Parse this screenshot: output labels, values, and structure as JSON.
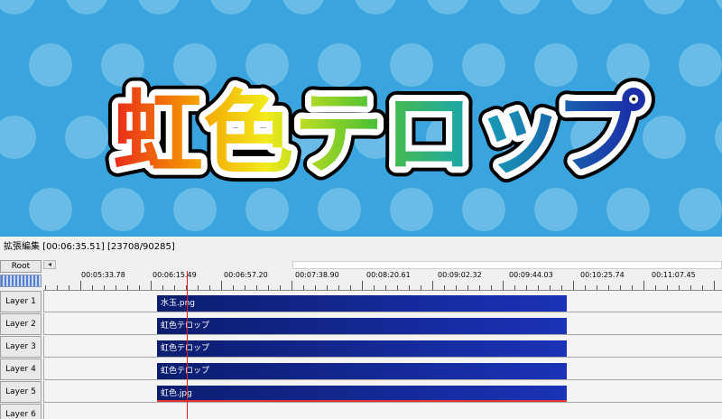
{
  "preview": {
    "title_chars": [
      "虹",
      "色",
      "テ",
      "ロ",
      "ッ",
      "プ"
    ],
    "background_color": "#3aa4de",
    "dot_color": "#6bbbe8"
  },
  "timeline": {
    "title": "拡張編集 [00:06:35.51] [23708/90285]",
    "root_label": "Root",
    "scroll_left_icon": "◂",
    "ruler_labels": [
      "00:05:33.78",
      "00:06:15.49",
      "00:06:57.20",
      "00:07:38.90",
      "00:08:20.61",
      "00:09:02.32",
      "00:09:44.03",
      "00:10:25.74",
      "00:11:07.45"
    ],
    "layers": [
      {
        "label": "Layer 1",
        "clip": "水玉.png"
      },
      {
        "label": "Layer 2",
        "clip": "虹色テロップ"
      },
      {
        "label": "Layer 3",
        "clip": "虹色テロップ"
      },
      {
        "label": "Layer 4",
        "clip": "虹色テロップ"
      },
      {
        "label": "Layer 5",
        "clip": "虹色.jpg"
      },
      {
        "label": "Layer 6",
        "clip": null
      }
    ],
    "clip_color_start": "#0c1d6e",
    "clip_color_end": "#1a33b8",
    "playhead_color": "#e02020"
  }
}
